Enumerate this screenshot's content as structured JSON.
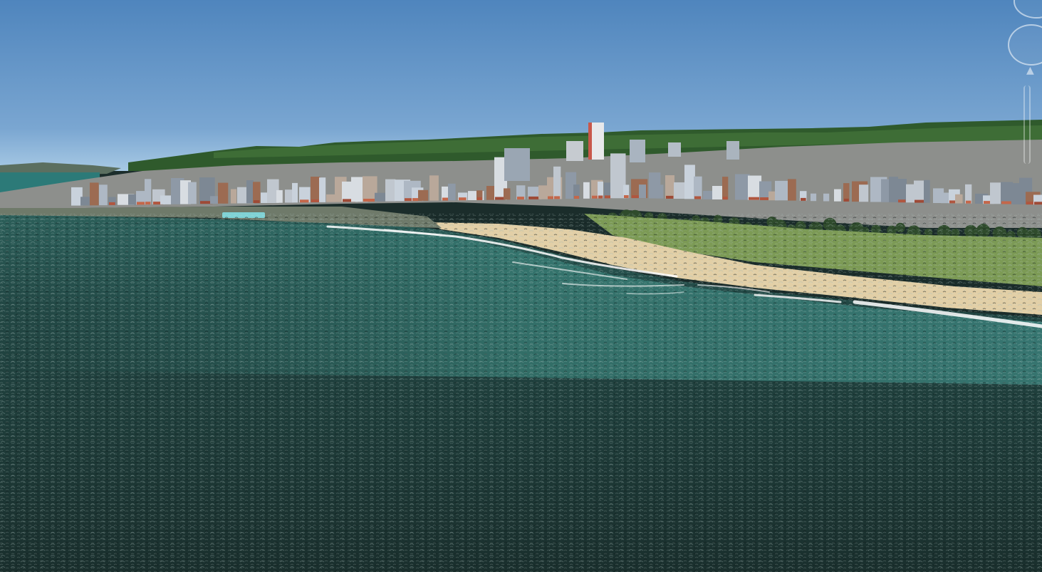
{
  "scene": {
    "description_colors": {
      "sky_top": "#4f85bd",
      "sky_horizon": "#9cc3e0",
      "escarpment": "#2f5a2c",
      "ocean_deep": "#173230",
      "ocean_shallow": "#3a7f78",
      "sand": "#e2cfa6",
      "grass": "#7c9a55",
      "surf": "#ffffff"
    }
  },
  "navigation": {
    "compass_icon": "compass-ring-icon",
    "look_icon": "look-joystick-icon",
    "zoom_icon": "zoom-slider-icon"
  }
}
